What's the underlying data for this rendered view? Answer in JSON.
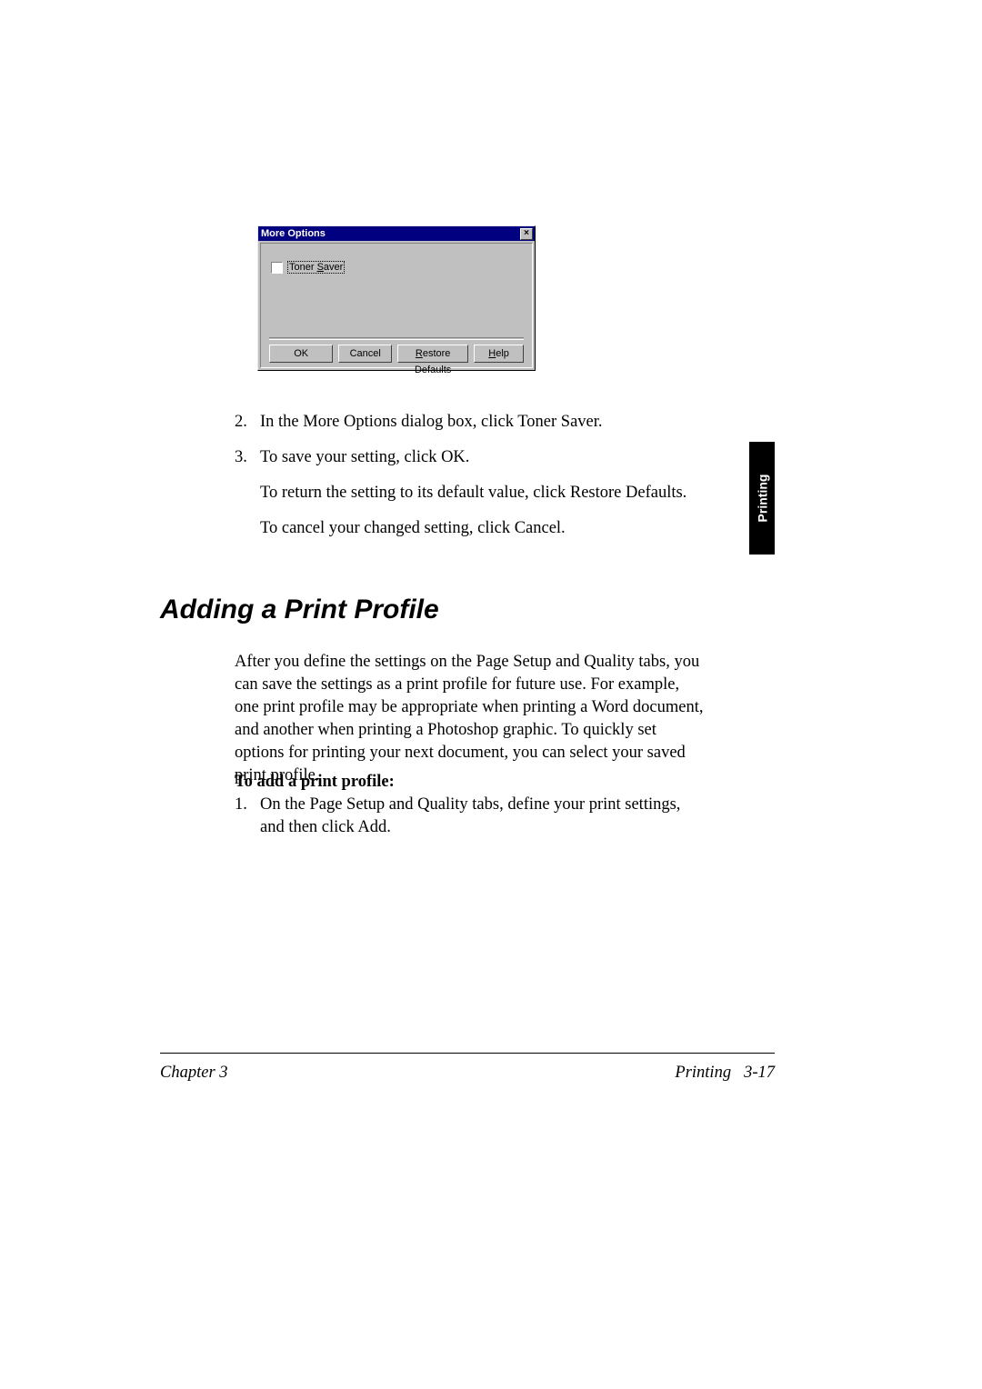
{
  "dialog": {
    "title": "More Options",
    "close_label": "×",
    "checkbox_pre": "Toner ",
    "checkbox_ul": "S",
    "checkbox_post": "aver",
    "buttons": {
      "ok": "OK",
      "cancel": "Cancel",
      "restore_ul": "R",
      "restore_post": "estore Defaults",
      "help_ul": "H",
      "help_post": "elp"
    }
  },
  "thumb_tab": "Printing",
  "steps": {
    "n2": "2.",
    "t2": "In the More Options dialog box, click Toner Saver.",
    "n3": "3.",
    "t3a": "To save your setting, click OK.",
    "t3b": "To return the setting to its default value, click Restore Defaults.",
    "t3c": "To cancel your changed setting, click Cancel."
  },
  "heading": "Adding a Print Profile",
  "intro": "After you define the settings on the Page Setup and Quality tabs, you can save the settings as a print profile for future use. For example, one print profile may be appropriate when printing a Word document, and another when printing a Photoshop graphic. To quickly set options for printing your next document, you can select your saved print profile.",
  "add_profile": {
    "heading": "To add a print profile:",
    "n1": "1.",
    "t1": "On the Page Setup and Quality tabs, define your print settings, and then click Add."
  },
  "footer": {
    "left": "Chapter 3",
    "right_label": "Printing",
    "right_page": "3-17"
  }
}
